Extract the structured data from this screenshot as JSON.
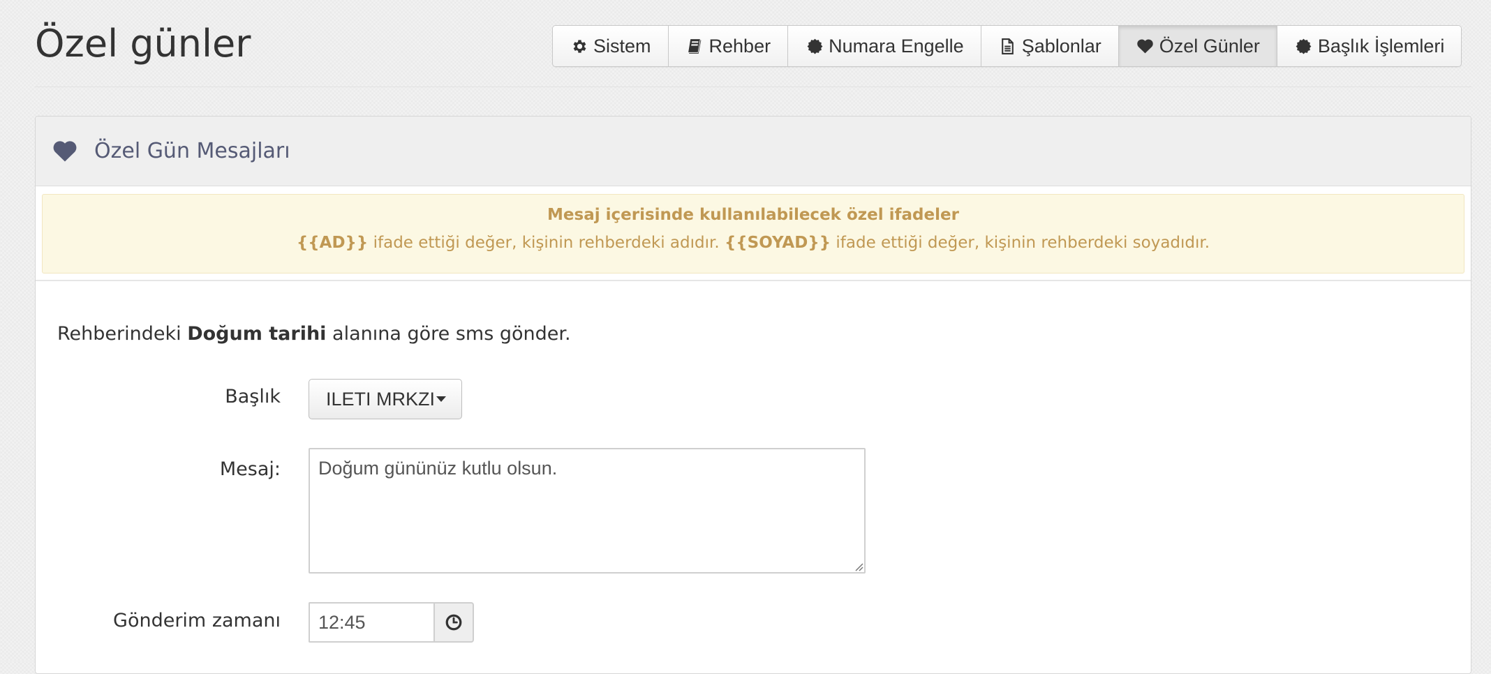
{
  "page": {
    "title": "Özel günler"
  },
  "nav": {
    "buttons": [
      {
        "label": "Sistem",
        "icon": "gear-icon"
      },
      {
        "label": "Rehber",
        "icon": "book-icon"
      },
      {
        "label": "Numara Engelle",
        "icon": "badge-icon"
      },
      {
        "label": "Şablonlar",
        "icon": "file-icon"
      },
      {
        "label": "Özel Günler",
        "icon": "heart-icon",
        "active": true
      },
      {
        "label": "Başlık İşlemleri",
        "icon": "badge-icon"
      }
    ]
  },
  "panel": {
    "title": "Özel Gün Mesajları",
    "icon": "heart-icon"
  },
  "alert": {
    "title": "Mesaj içerisinde kullanılabilecek özel ifadeler",
    "ad_token": "{{AD}}",
    "ad_text": " ifade ettiği değer, kişinin rehberdeki adıdır. ",
    "soyad_token": "{{SOYAD}}",
    "soyad_text": " ifade ettiği değer, kişinin rehberdeki soyadıdır."
  },
  "intro": {
    "prefix": "Rehberindeki ",
    "bold": "Doğum tarihi",
    "suffix": " alanına göre sms gönder."
  },
  "form": {
    "header_label": "Başlık",
    "header_value": "ILETI MRKZI",
    "message_label": "Mesaj:",
    "message_value": "Doğum gününüz kutlu olsun.",
    "time_label": "Gönderim zamanı",
    "time_value": "12:45"
  },
  "colors": {
    "alert_text": "#c09853",
    "alert_bg": "#fcf8e3",
    "panel_title": "#555a75"
  }
}
